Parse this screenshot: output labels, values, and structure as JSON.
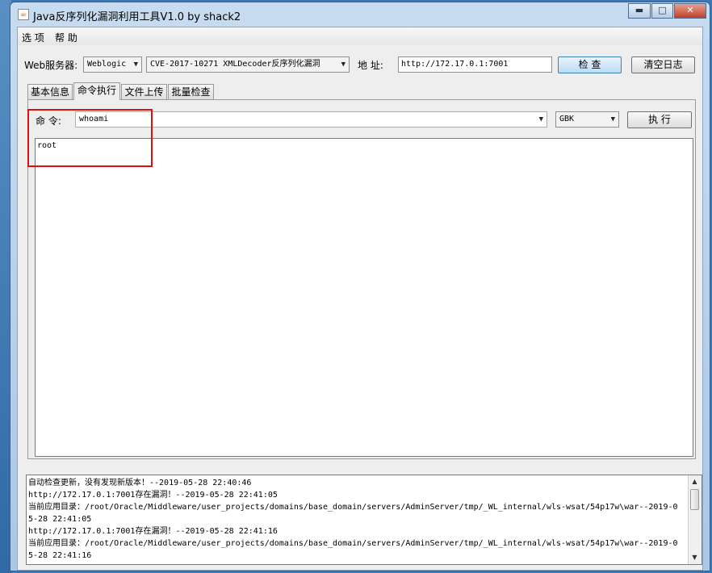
{
  "window": {
    "title": "Java反序列化漏洞利用工具V1.0 by shack2",
    "icon": "java-icon",
    "controls": {
      "minimize": "▬",
      "maximize": "□",
      "close": "✕"
    }
  },
  "menu": [
    "选 项",
    "帮 助"
  ],
  "toolbar": {
    "server_label": "Web服务器:",
    "server_value": "Weblogic",
    "vuln_value": "CVE-2017-10271 XMLDecoder反序列化漏洞",
    "address_label": "地 址:",
    "address_value": "http://172.17.0.1:7001",
    "check_label": "检 查",
    "clear_label": "清空日志"
  },
  "tabs": [
    "基本信息",
    "命令执行",
    "文件上传",
    "批量检查"
  ],
  "active_tab": "命令执行",
  "command": {
    "label": "命 令:",
    "value": "whoami",
    "encoding": "GBK",
    "execute_label": "执 行",
    "output": "root"
  },
  "log": [
    "自动检查更新，没有发现新版本！--2019-05-28 22:40:46",
    "http://172.17.0.1:7001存在漏洞！--2019-05-28 22:41:05",
    "当前应用目录：/root/Oracle/Middleware/user_projects/domains/base_domain/servers/AdminServer/tmp/_WL_internal/wls-wsat/54p17w\\war--2019-0",
    "5-28 22:41:05",
    "http://172.17.0.1:7001存在漏洞！--2019-05-28 22:41:16",
    "当前应用目录：/root/Oracle/Middleware/user_projects/domains/base_domain/servers/AdminServer/tmp/_WL_internal/wls-wsat/54p17w\\war--2019-0",
    "5-28 22:41:16"
  ],
  "colors": {
    "highlight_box": "#e01010",
    "check_button": "#bcdcf6"
  }
}
